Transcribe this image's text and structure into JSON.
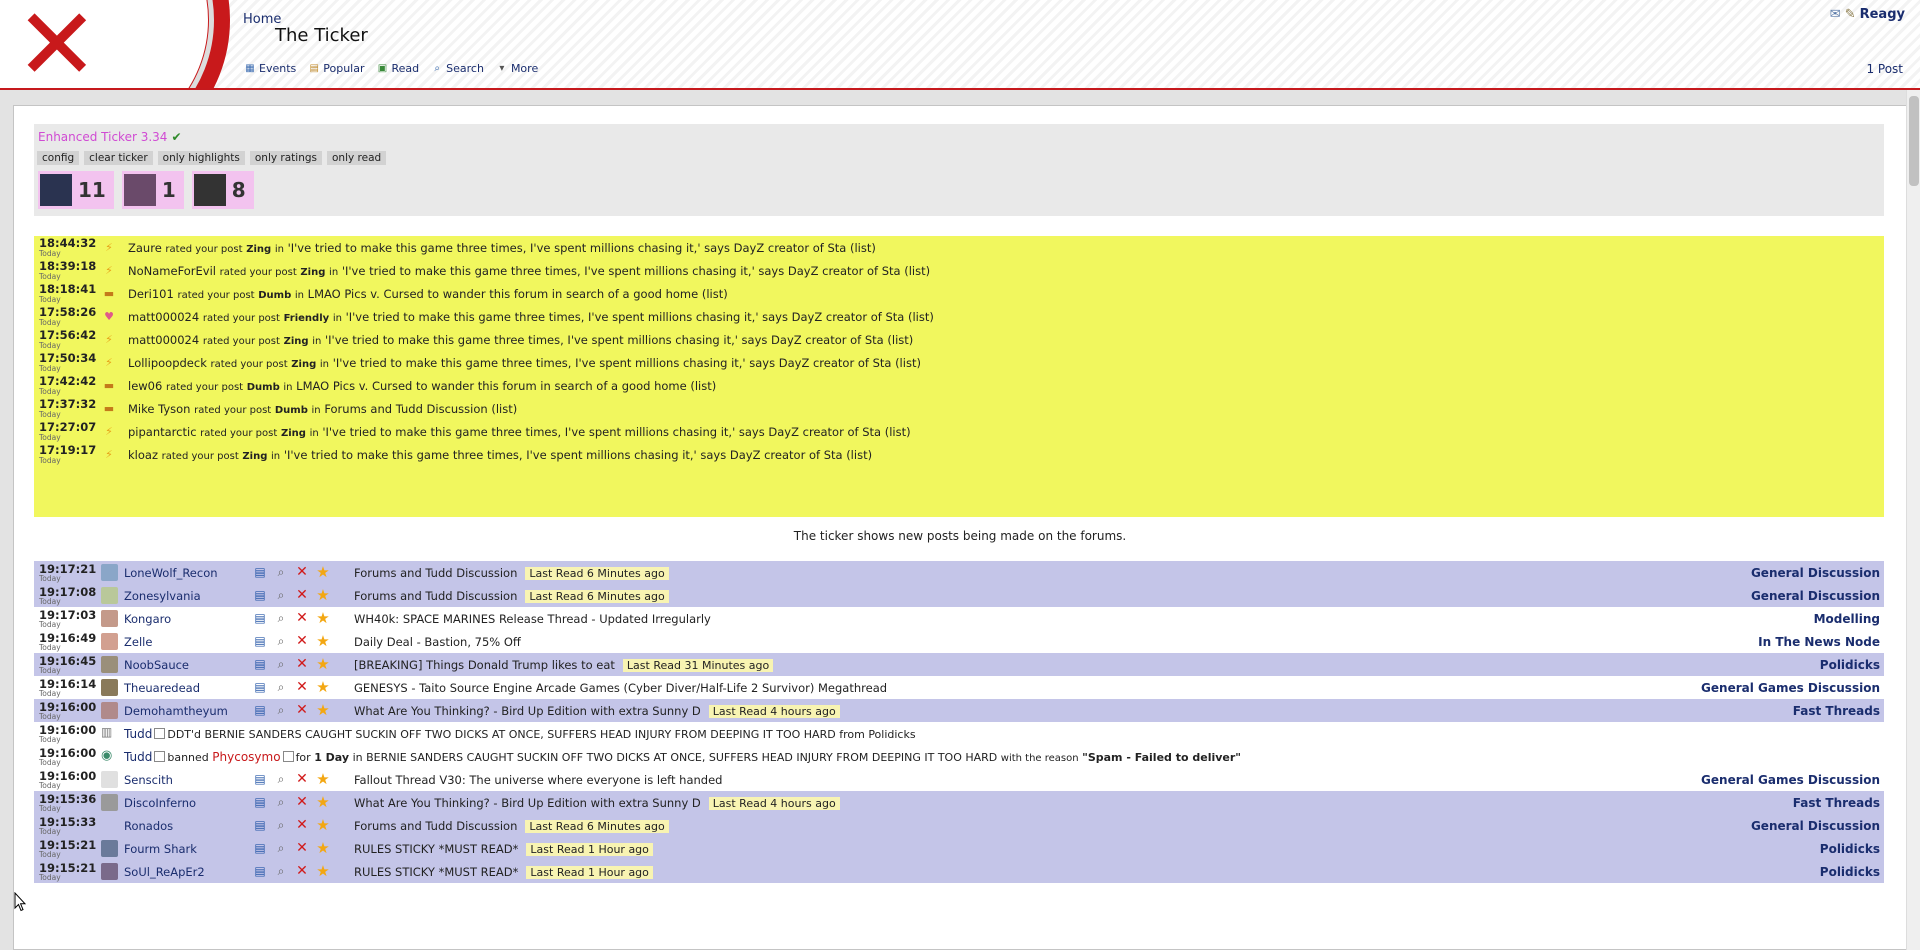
{
  "header": {
    "breadcrumb": "Home",
    "title": "The Ticker",
    "username": "Reagy",
    "post_count": "1 Post",
    "nav": [
      {
        "label": "Events",
        "icon": "calendar-icon"
      },
      {
        "label": "Popular",
        "icon": "popular-icon"
      },
      {
        "label": "Read",
        "icon": "read-icon"
      },
      {
        "label": "Search",
        "icon": "search-icon"
      },
      {
        "label": "More",
        "icon": "chevron-down-icon"
      }
    ]
  },
  "ticker": {
    "title": "Enhanced Ticker 3.34",
    "buttons": [
      "config",
      "clear ticker",
      "only highlights",
      "only ratings",
      "only read"
    ],
    "badges": [
      {
        "count": "11",
        "avatar_color": "#2a3350"
      },
      {
        "count": "1",
        "avatar_color": "#6a4a6a"
      },
      {
        "count": "8",
        "avatar_color": "#333333"
      }
    ]
  },
  "ratings": [
    {
      "time": "18:44:32",
      "day": "Today",
      "icon": "zing-icon",
      "user": "Zaure",
      "mid": "rated your post",
      "rating": "Zing",
      "in": "in",
      "thread": "'I've tried to make this game three times, I've spent millions chasing it,' says DayZ creator of Sta (list)"
    },
    {
      "time": "18:39:18",
      "day": "Today",
      "icon": "zing-icon",
      "user": "NoNameForEvil",
      "mid": "rated your post",
      "rating": "Zing",
      "in": "in",
      "thread": "'I've tried to make this game three times, I've spent millions chasing it,' says DayZ creator of Sta (list)"
    },
    {
      "time": "18:18:41",
      "day": "Today",
      "icon": "dumb-icon",
      "user": "Deri101",
      "mid": "rated your post",
      "rating": "Dumb",
      "in": "in",
      "thread": "LMAO Pics v. Cursed to wander this forum in search of a good home (list)"
    },
    {
      "time": "17:58:26",
      "day": "Today",
      "icon": "friendly-icon",
      "user": "matt000024",
      "mid": "rated your post",
      "rating": "Friendly",
      "in": "in",
      "thread": "'I've tried to make this game three times, I've spent millions chasing it,' says DayZ creator of Sta (list)"
    },
    {
      "time": "17:56:42",
      "day": "Today",
      "icon": "zing-icon",
      "user": "matt000024",
      "mid": "rated your post",
      "rating": "Zing",
      "in": "in",
      "thread": "'I've tried to make this game three times, I've spent millions chasing it,' says DayZ creator of Sta (list)"
    },
    {
      "time": "17:50:34",
      "day": "Today",
      "icon": "zing-icon",
      "user": "Lollipoopdeck",
      "mid": "rated your post",
      "rating": "Zing",
      "in": "in",
      "thread": "'I've tried to make this game three times, I've spent millions chasing it,' says DayZ creator of Sta (list)"
    },
    {
      "time": "17:42:42",
      "day": "Today",
      "icon": "dumb-icon",
      "user": "lew06",
      "mid": "rated your post",
      "rating": "Dumb",
      "in": "in",
      "thread": "LMAO Pics v. Cursed to wander this forum in search of a good home (list)"
    },
    {
      "time": "17:37:32",
      "day": "Today",
      "icon": "dumb-icon",
      "user": "Mike Tyson",
      "mid": "rated your post",
      "rating": "Dumb",
      "in": "in",
      "thread": "Forums and Tudd Discussion (list)"
    },
    {
      "time": "17:27:07",
      "day": "Today",
      "icon": "zing-icon",
      "user": "pipantarctic",
      "mid": "rated your post",
      "rating": "Zing",
      "in": "in",
      "thread": "'I've tried to make this game three times, I've spent millions chasing it,' says DayZ creator of Sta (list)"
    },
    {
      "time": "17:19:17",
      "day": "Today",
      "icon": "zing-icon",
      "user": "kloaz",
      "mid": "rated your post",
      "rating": "Zing",
      "in": "in",
      "thread": "'I've tried to make this game three times, I've spent millions chasing it,' says DayZ creator of Sta (list)"
    }
  ],
  "info_line": "The ticker shows new posts being made on the forums.",
  "feed": [
    {
      "type": "post",
      "bg": "lav",
      "time": "19:17:21",
      "day": "Today",
      "user": "LoneWolf_Recon",
      "avatar_color": "#8aa6c8",
      "title": "Forums and Tudd Discussion",
      "lastread": "Last Read 6 Minutes ago",
      "forum": "General Discussion"
    },
    {
      "type": "post",
      "bg": "lav",
      "time": "19:17:08",
      "day": "Today",
      "user": "Zonesylvania",
      "avatar_color": "#b9c89a",
      "title": "Forums and Tudd Discussion",
      "lastread": "Last Read 6 Minutes ago",
      "forum": "General Discussion"
    },
    {
      "type": "post",
      "bg": "white",
      "time": "19:17:03",
      "day": "Today",
      "user": "Kongaro",
      "avatar_color": "#c49a8a",
      "title": "WH40k: SPACE MARINES Release Thread - Updated Irregularly",
      "lastread": "",
      "forum": "Modelling"
    },
    {
      "type": "post",
      "bg": "white",
      "time": "19:16:49",
      "day": "Today",
      "user": "Zelle",
      "avatar_color": "#d2a090",
      "title": "Daily Deal - Bastion, 75% Off",
      "lastread": "",
      "forum": "In The News Node"
    },
    {
      "type": "post",
      "bg": "lav",
      "time": "19:16:45",
      "day": "Today",
      "user": "NoobSauce",
      "avatar_color": "#9a8f7a",
      "title": "[BREAKING] Things Donald Trump likes to eat",
      "lastread": "Last Read 31 Minutes ago",
      "forum": "Polidicks"
    },
    {
      "type": "post",
      "bg": "white",
      "time": "19:16:14",
      "day": "Today",
      "user": "Theuaredead",
      "avatar_color": "#8a7a5a",
      "title": "GENESYS - Taito Source Engine Arcade Games (Cyber Diver/Half-Life 2 Survivor) Megathread",
      "lastread": "",
      "forum": "General Games Discussion"
    },
    {
      "type": "post",
      "bg": "lav",
      "time": "19:16:00",
      "day": "Today",
      "user": "Demohamtheyum",
      "avatar_color": "#b08a8a",
      "title": "What Are You Thinking? - Bird Up Edition with extra Sunny D",
      "lastread": "Last Read 4 hours ago",
      "forum": "Fast Threads"
    },
    {
      "type": "ddt",
      "bg": "white",
      "time": "19:16:00",
      "day": "Today",
      "icon": "ddt-icon",
      "actor": "Tudd",
      "action": "DDT'd",
      "target": "BERNIE SANDERS CAUGHT SUCKIN OFF TWO DICKS AT ONCE, SUFFERS HEAD INJURY FROM DEEPING IT TOO HARD",
      "from_word": "from",
      "forum": "Polidicks"
    },
    {
      "type": "ban",
      "bg": "white",
      "time": "19:16:00",
      "day": "Today",
      "icon": "ban-icon",
      "actor": "Tudd",
      "action": "banned",
      "victim": "Phycosymo",
      "for_word": "for",
      "duration": "1 Day",
      "in_word": "in",
      "target": "BERNIE SANDERS CAUGHT SUCKIN OFF TWO DICKS AT ONCE, SUFFERS HEAD INJURY FROM DEEPING IT TOO HARD",
      "reason_prefix": "with the reason",
      "reason": "\"Spam - Failed to deliver\""
    },
    {
      "type": "post",
      "bg": "white",
      "time": "19:16:00",
      "day": "Today",
      "user": "Senscith",
      "avatar_color": "#e0e0e0",
      "title": "Fallout Thread V30: The universe where everyone is left handed",
      "lastread": "",
      "forum": "General Games Discussion"
    },
    {
      "type": "post",
      "bg": "lav",
      "time": "19:15:36",
      "day": "Today",
      "user": "DiscoInferno",
      "avatar_color": "#9a9a9a",
      "title": "What Are You Thinking? - Bird Up Edition with extra Sunny D",
      "lastread": "Last Read 4 hours ago",
      "forum": "Fast Threads"
    },
    {
      "type": "post",
      "bg": "lav",
      "time": "19:15:33",
      "day": "Today",
      "user": "Ronados",
      "avatar_color": "#c4c5e8",
      "title": "Forums and Tudd Discussion",
      "lastread": "Last Read 6 Minutes ago",
      "forum": "General Discussion"
    },
    {
      "type": "post",
      "bg": "lav",
      "time": "19:15:21",
      "day": "Today",
      "user": "Fourm Shark",
      "avatar_color": "#6a7a9a",
      "title": "RULES STICKY *MUST READ*",
      "lastread": "Last Read 1 Hour ago",
      "forum": "Polidicks"
    },
    {
      "type": "post",
      "bg": "lav",
      "time": "19:15:21",
      "day": "Today",
      "user": "SoUl_ReApEr2",
      "avatar_color": "#7a6a8a",
      "title": "RULES STICKY *MUST READ*",
      "lastread": "Last Read 1 Hour ago",
      "forum": "Polidicks"
    }
  ],
  "colors": {
    "accent_red": "#c8191b",
    "rating_bg": "#f1f75e",
    "row_lavender": "#c4c5e8",
    "link_blue": "#1a2d6e",
    "ticker_title": "#d04ad3"
  }
}
